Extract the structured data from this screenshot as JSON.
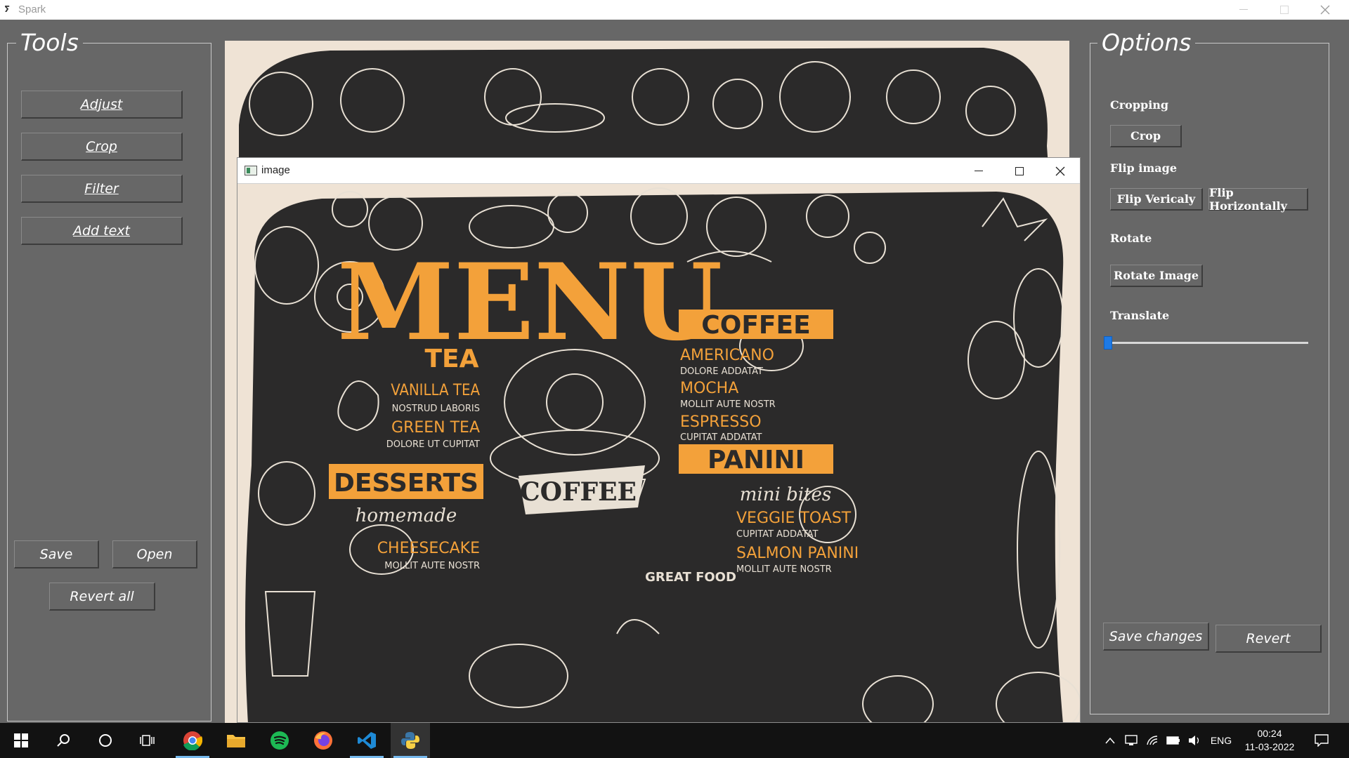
{
  "app": {
    "title": "Spark"
  },
  "tools": {
    "title": "Tools",
    "buttons": {
      "adjust": "Adjust",
      "crop": "Crop",
      "filter": "Filter",
      "add_text": "Add text"
    },
    "save": "Save",
    "open": "Open",
    "revert_all": "Revert all"
  },
  "options": {
    "title": "Options",
    "cropping_label": "Cropping",
    "crop_button": "Crop",
    "flip_label": "Flip image",
    "flip_vertical": "Flip Vericaly",
    "flip_horizontal": "Flip Horizontally",
    "rotate_label": "Rotate",
    "rotate_button": "Rotate Image",
    "translate_label": "Translate",
    "translate_value": 0,
    "save_changes": "Save changes",
    "revert": "Revert"
  },
  "image_window": {
    "title": "image"
  },
  "menu_art": {
    "heading": "MENU",
    "tea": {
      "title": "TEA",
      "items": [
        "VANILLA TEA",
        "NOSTRUD LABORIS",
        "GREEN TEA",
        "DOLORE UT CUPITAT"
      ]
    },
    "desserts": {
      "title": "DESSERTS",
      "sub": "homemade",
      "items": [
        "CHEESECAKE",
        "MOLLIT AUTE NOSTR"
      ]
    },
    "coffee": {
      "title": "COFFEE",
      "items": [
        "AMERICANO",
        "DOLORE ADDATAT",
        "MOCHA",
        "MOLLIT AUTE NOSTR",
        "ESPRESSO",
        "CUPITAT ADDATAT"
      ]
    },
    "panini": {
      "title": "PANINI",
      "sub": "mini bites",
      "items": [
        "VEGGIE TOAST",
        "CUPITAT ADDATAT",
        "SALMON PANINI",
        "MOLLIT AUTE NOSTR"
      ]
    },
    "ribbon": "COFFEE",
    "great_food": "GREAT FOOD",
    "colors": {
      "orange": "#f3a13a",
      "board": "#2b2a2a",
      "paper": "#efe3d5",
      "chalk": "#e8e0d4"
    }
  },
  "taskbar": {
    "apps": [
      "windows-start-icon",
      "search-icon",
      "cortana-icon",
      "task-view-icon",
      "chrome-icon",
      "file-explorer-icon",
      "spotify-icon",
      "firefox-icon",
      "vscode-icon",
      "python-icon"
    ],
    "language": "ENG",
    "time": "00:24",
    "date": "11-03-2022"
  }
}
